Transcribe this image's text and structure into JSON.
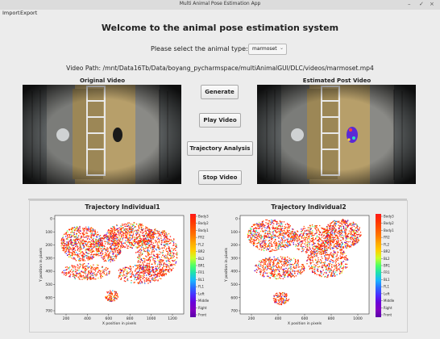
{
  "window": {
    "title": "Multi Animal Pose Estimation App"
  },
  "menu": {
    "items": [
      "Import",
      "Export"
    ]
  },
  "header": {
    "title": "Welcome to the animal pose estimation system"
  },
  "animal_select": {
    "label": "Please select the animal type:",
    "value": "marmoset"
  },
  "video_path": {
    "text": "Video Path: /mnt/Data16Tb/Data/boyang_pycharmspace/multiAnimalGUI/DLC/videos/marmoset.mp4"
  },
  "videos": {
    "original_label": "Original Video",
    "estimated_label": "Estimated Post Video"
  },
  "buttons": {
    "generate": "Generate",
    "play": "Play Video",
    "trajectory": "Trajectory Analysis",
    "stop": "Stop Video"
  },
  "plots": [
    {
      "title": "Trajectory Individual1",
      "xlabel": "X position in pixels",
      "ylabel": "Y position in pixels",
      "xticks": [
        "200",
        "400",
        "600",
        "800",
        "1000",
        "1200"
      ],
      "yticks": [
        "0",
        "100",
        "200",
        "300",
        "400",
        "500",
        "600",
        "700"
      ],
      "legend": [
        "Body3",
        "Body2",
        "Body1",
        "FR2",
        "FL2",
        "BR2",
        "BL2",
        "BR1",
        "FR1",
        "BL1",
        "FL1",
        "Left",
        "Middle",
        "Right",
        "Front"
      ]
    },
    {
      "title": "Trajectory Individual2",
      "xlabel": "X position in pixels",
      "ylabel": "Y position in pixels",
      "xticks": [
        "200",
        "400",
        "600",
        "800",
        "1000"
      ],
      "yticks": [
        "0",
        "100",
        "200",
        "300",
        "400",
        "500",
        "600",
        "700"
      ],
      "legend": [
        "Body3",
        "Body2",
        "Body1",
        "FR2",
        "FL2",
        "BR2",
        "BL2",
        "BR1",
        "FR1",
        "BL1",
        "FL1",
        "Left",
        "Middle",
        "Right",
        "Front"
      ]
    }
  ],
  "colors": {
    "heat_top": "#d7191c",
    "heat_mid": "#1ec6a3",
    "heat_bottom": "#6a00d8",
    "window_bg": "#ececec"
  }
}
